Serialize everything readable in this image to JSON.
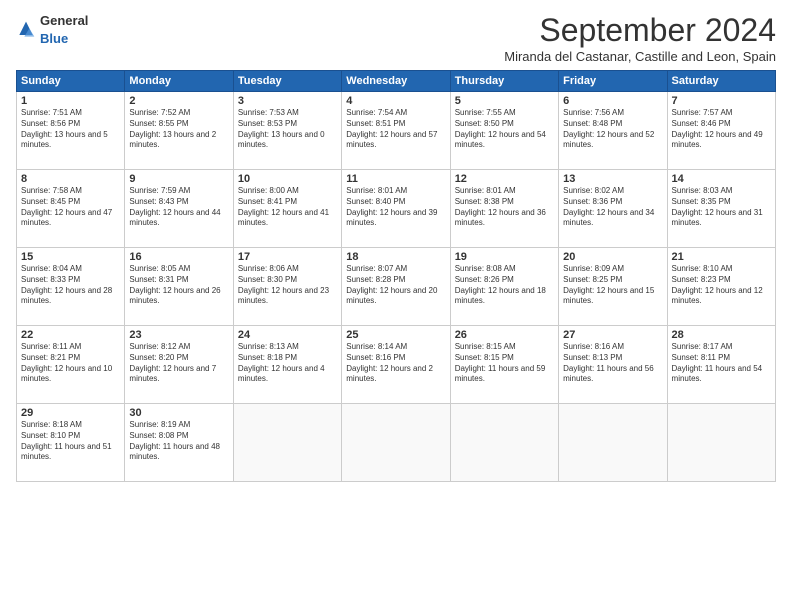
{
  "logo": {
    "general": "General",
    "blue": "Blue"
  },
  "title": "September 2024",
  "location": "Miranda del Castanar, Castille and Leon, Spain",
  "days": [
    "Sunday",
    "Monday",
    "Tuesday",
    "Wednesday",
    "Thursday",
    "Friday",
    "Saturday"
  ],
  "weeks": [
    [
      {
        "day": "1",
        "sunrise": "Sunrise: 7:51 AM",
        "sunset": "Sunset: 8:56 PM",
        "daylight": "Daylight: 13 hours and 5 minutes."
      },
      {
        "day": "2",
        "sunrise": "Sunrise: 7:52 AM",
        "sunset": "Sunset: 8:55 PM",
        "daylight": "Daylight: 13 hours and 2 minutes."
      },
      {
        "day": "3",
        "sunrise": "Sunrise: 7:53 AM",
        "sunset": "Sunset: 8:53 PM",
        "daylight": "Daylight: 13 hours and 0 minutes."
      },
      {
        "day": "4",
        "sunrise": "Sunrise: 7:54 AM",
        "sunset": "Sunset: 8:51 PM",
        "daylight": "Daylight: 12 hours and 57 minutes."
      },
      {
        "day": "5",
        "sunrise": "Sunrise: 7:55 AM",
        "sunset": "Sunset: 8:50 PM",
        "daylight": "Daylight: 12 hours and 54 minutes."
      },
      {
        "day": "6",
        "sunrise": "Sunrise: 7:56 AM",
        "sunset": "Sunset: 8:48 PM",
        "daylight": "Daylight: 12 hours and 52 minutes."
      },
      {
        "day": "7",
        "sunrise": "Sunrise: 7:57 AM",
        "sunset": "Sunset: 8:46 PM",
        "daylight": "Daylight: 12 hours and 49 minutes."
      }
    ],
    [
      {
        "day": "8",
        "sunrise": "Sunrise: 7:58 AM",
        "sunset": "Sunset: 8:45 PM",
        "daylight": "Daylight: 12 hours and 47 minutes."
      },
      {
        "day": "9",
        "sunrise": "Sunrise: 7:59 AM",
        "sunset": "Sunset: 8:43 PM",
        "daylight": "Daylight: 12 hours and 44 minutes."
      },
      {
        "day": "10",
        "sunrise": "Sunrise: 8:00 AM",
        "sunset": "Sunset: 8:41 PM",
        "daylight": "Daylight: 12 hours and 41 minutes."
      },
      {
        "day": "11",
        "sunrise": "Sunrise: 8:01 AM",
        "sunset": "Sunset: 8:40 PM",
        "daylight": "Daylight: 12 hours and 39 minutes."
      },
      {
        "day": "12",
        "sunrise": "Sunrise: 8:01 AM",
        "sunset": "Sunset: 8:38 PM",
        "daylight": "Daylight: 12 hours and 36 minutes."
      },
      {
        "day": "13",
        "sunrise": "Sunrise: 8:02 AM",
        "sunset": "Sunset: 8:36 PM",
        "daylight": "Daylight: 12 hours and 34 minutes."
      },
      {
        "day": "14",
        "sunrise": "Sunrise: 8:03 AM",
        "sunset": "Sunset: 8:35 PM",
        "daylight": "Daylight: 12 hours and 31 minutes."
      }
    ],
    [
      {
        "day": "15",
        "sunrise": "Sunrise: 8:04 AM",
        "sunset": "Sunset: 8:33 PM",
        "daylight": "Daylight: 12 hours and 28 minutes."
      },
      {
        "day": "16",
        "sunrise": "Sunrise: 8:05 AM",
        "sunset": "Sunset: 8:31 PM",
        "daylight": "Daylight: 12 hours and 26 minutes."
      },
      {
        "day": "17",
        "sunrise": "Sunrise: 8:06 AM",
        "sunset": "Sunset: 8:30 PM",
        "daylight": "Daylight: 12 hours and 23 minutes."
      },
      {
        "day": "18",
        "sunrise": "Sunrise: 8:07 AM",
        "sunset": "Sunset: 8:28 PM",
        "daylight": "Daylight: 12 hours and 20 minutes."
      },
      {
        "day": "19",
        "sunrise": "Sunrise: 8:08 AM",
        "sunset": "Sunset: 8:26 PM",
        "daylight": "Daylight: 12 hours and 18 minutes."
      },
      {
        "day": "20",
        "sunrise": "Sunrise: 8:09 AM",
        "sunset": "Sunset: 8:25 PM",
        "daylight": "Daylight: 12 hours and 15 minutes."
      },
      {
        "day": "21",
        "sunrise": "Sunrise: 8:10 AM",
        "sunset": "Sunset: 8:23 PM",
        "daylight": "Daylight: 12 hours and 12 minutes."
      }
    ],
    [
      {
        "day": "22",
        "sunrise": "Sunrise: 8:11 AM",
        "sunset": "Sunset: 8:21 PM",
        "daylight": "Daylight: 12 hours and 10 minutes."
      },
      {
        "day": "23",
        "sunrise": "Sunrise: 8:12 AM",
        "sunset": "Sunset: 8:20 PM",
        "daylight": "Daylight: 12 hours and 7 minutes."
      },
      {
        "day": "24",
        "sunrise": "Sunrise: 8:13 AM",
        "sunset": "Sunset: 8:18 PM",
        "daylight": "Daylight: 12 hours and 4 minutes."
      },
      {
        "day": "25",
        "sunrise": "Sunrise: 8:14 AM",
        "sunset": "Sunset: 8:16 PM",
        "daylight": "Daylight: 12 hours and 2 minutes."
      },
      {
        "day": "26",
        "sunrise": "Sunrise: 8:15 AM",
        "sunset": "Sunset: 8:15 PM",
        "daylight": "Daylight: 11 hours and 59 minutes."
      },
      {
        "day": "27",
        "sunrise": "Sunrise: 8:16 AM",
        "sunset": "Sunset: 8:13 PM",
        "daylight": "Daylight: 11 hours and 56 minutes."
      },
      {
        "day": "28",
        "sunrise": "Sunrise: 8:17 AM",
        "sunset": "Sunset: 8:11 PM",
        "daylight": "Daylight: 11 hours and 54 minutes."
      }
    ],
    [
      {
        "day": "29",
        "sunrise": "Sunrise: 8:18 AM",
        "sunset": "Sunset: 8:10 PM",
        "daylight": "Daylight: 11 hours and 51 minutes."
      },
      {
        "day": "30",
        "sunrise": "Sunrise: 8:19 AM",
        "sunset": "Sunset: 8:08 PM",
        "daylight": "Daylight: 11 hours and 48 minutes."
      },
      null,
      null,
      null,
      null,
      null
    ]
  ]
}
